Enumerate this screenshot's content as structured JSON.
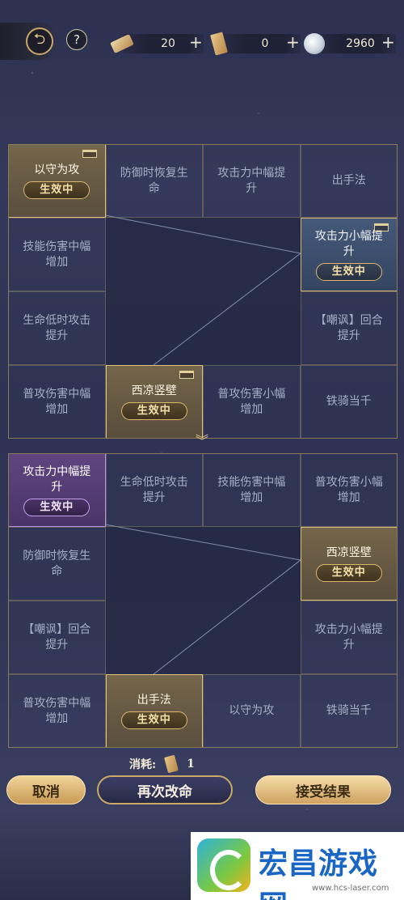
{
  "resources": [
    {
      "icon": "scroll-icon",
      "value": "20",
      "plus": "+"
    },
    {
      "icon": "paper-bundle-icon",
      "value": "0",
      "plus": "+"
    },
    {
      "icon": "moon-coin-icon",
      "value": "2960",
      "plus": "+"
    }
  ],
  "header": {
    "back_glyph": "⮌",
    "help_glyph": "?"
  },
  "badge_text": "生效中",
  "top_grid": {
    "cells": [
      {
        "label": "以守为攻",
        "state": "active-gold",
        "tag": true
      },
      {
        "label": "防御时恢复生命",
        "state": "dim"
      },
      {
        "label": "攻击力中幅提升",
        "state": "dim"
      },
      {
        "label": "出手法",
        "state": "dim"
      },
      {
        "label": "技能伤害中幅增加",
        "state": "dim"
      },
      {
        "label": "攻击力小幅提升",
        "state": "active-blue",
        "tag": true
      },
      {
        "label": "生命低时攻击提升",
        "state": "dim"
      },
      {
        "label": "【嘲讽】回合提升",
        "state": "dim"
      },
      {
        "label": "普攻伤害中幅增加",
        "state": "dim"
      },
      {
        "label": "西凉竖壁",
        "state": "active-gold",
        "tag": true
      },
      {
        "label": "普攻伤害小幅增加",
        "state": "dim"
      },
      {
        "label": "铁骑当千",
        "state": "dim"
      }
    ]
  },
  "bottom_grid": {
    "cells": [
      {
        "label": "攻击力中幅提升",
        "state": "active-purple"
      },
      {
        "label": "生命低时攻击提升",
        "state": "dim"
      },
      {
        "label": "技能伤害中幅增加",
        "state": "dim"
      },
      {
        "label": "普攻伤害小幅增加",
        "state": "dim"
      },
      {
        "label": "防御时恢复生命",
        "state": "dim"
      },
      {
        "label": "西凉竖壁",
        "state": "active-gold"
      },
      {
        "label": "【嘲讽】回合提升",
        "state": "dim"
      },
      {
        "label": "攻击力小幅提升",
        "state": "dim"
      },
      {
        "label": "普攻伤害中幅增加",
        "state": "dim"
      },
      {
        "label": "出手法",
        "state": "active-gold"
      },
      {
        "label": "以守为攻",
        "state": "dim"
      },
      {
        "label": "铁骑当千",
        "state": "dim"
      }
    ]
  },
  "cost": {
    "label": "消耗:",
    "icon": "paper-bundle-icon",
    "value": "1"
  },
  "buttons": {
    "cancel": "取消",
    "retry": "再次改命",
    "accept": "接受结果"
  },
  "watermark": {
    "title": "宏昌游戏网",
    "url": "www.hcs-laser.com"
  }
}
